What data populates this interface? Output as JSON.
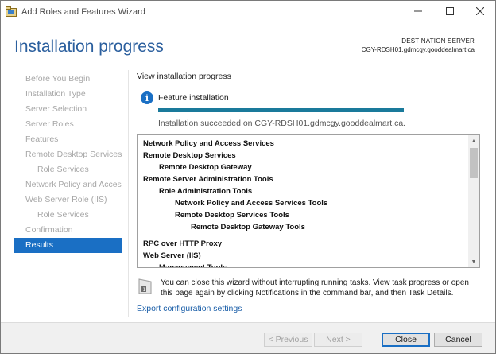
{
  "window": {
    "title": "Add Roles and Features Wizard",
    "controls": {
      "minimize": "minimize-icon",
      "maximize": "maximize-icon",
      "close": "close-icon"
    }
  },
  "header": {
    "title": "Installation progress",
    "destination_label": "DESTINATION SERVER",
    "destination_server": "CGY-RDSH01.gdmcgy.gooddealmart.ca"
  },
  "nav": {
    "items": [
      {
        "label": "Before You Begin",
        "sub": false,
        "active": false
      },
      {
        "label": "Installation Type",
        "sub": false,
        "active": false
      },
      {
        "label": "Server Selection",
        "sub": false,
        "active": false
      },
      {
        "label": "Server Roles",
        "sub": false,
        "active": false
      },
      {
        "label": "Features",
        "sub": false,
        "active": false
      },
      {
        "label": "Remote Desktop Services",
        "sub": false,
        "active": false
      },
      {
        "label": "Role Services",
        "sub": true,
        "active": false
      },
      {
        "label": "Network Policy and Acces...",
        "sub": false,
        "active": false
      },
      {
        "label": "Web Server Role (IIS)",
        "sub": false,
        "active": false
      },
      {
        "label": "Role Services",
        "sub": true,
        "active": false
      },
      {
        "label": "Confirmation",
        "sub": false,
        "active": false
      },
      {
        "label": "Results",
        "sub": false,
        "active": true
      }
    ]
  },
  "content": {
    "heading": "View installation progress",
    "feature_label": "Feature installation",
    "progress_fraction": 1.0,
    "status": "Installation succeeded on CGY-RDSH01.gdmcgy.gooddealmart.ca.",
    "results": [
      {
        "text": "Network Policy and Access Services",
        "level": 1,
        "gap": false
      },
      {
        "text": "Remote Desktop Services",
        "level": 1,
        "gap": false
      },
      {
        "text": "Remote Desktop Gateway",
        "level": 2,
        "gap": false
      },
      {
        "text": "Remote Server Administration Tools",
        "level": 1,
        "gap": false
      },
      {
        "text": "Role Administration Tools",
        "level": 2,
        "gap": false
      },
      {
        "text": "Network Policy and Access Services Tools",
        "level": 3,
        "gap": false
      },
      {
        "text": "Remote Desktop Services Tools",
        "level": 3,
        "gap": false
      },
      {
        "text": "Remote Desktop Gateway Tools",
        "level": 4,
        "gap": false
      },
      {
        "text": "RPC over HTTP Proxy",
        "level": 1,
        "gap": true
      },
      {
        "text": "Web Server (IIS)",
        "level": 1,
        "gap": false
      },
      {
        "text": "Management Tools",
        "level": 2,
        "gap": false
      }
    ],
    "notice": "You can close this wizard without interrupting running tasks. View task progress or open this page again by clicking Notifications in the command bar, and then Task Details.",
    "export_link": "Export configuration settings"
  },
  "footer": {
    "previous": "< Previous",
    "next": "Next >",
    "close": "Close",
    "cancel": "Cancel"
  },
  "colors": {
    "accent": "#1a6fc4",
    "title_blue": "#2b5f9e",
    "progress": "#1a7a9b",
    "nav_inactive": "#a7a7a7"
  }
}
